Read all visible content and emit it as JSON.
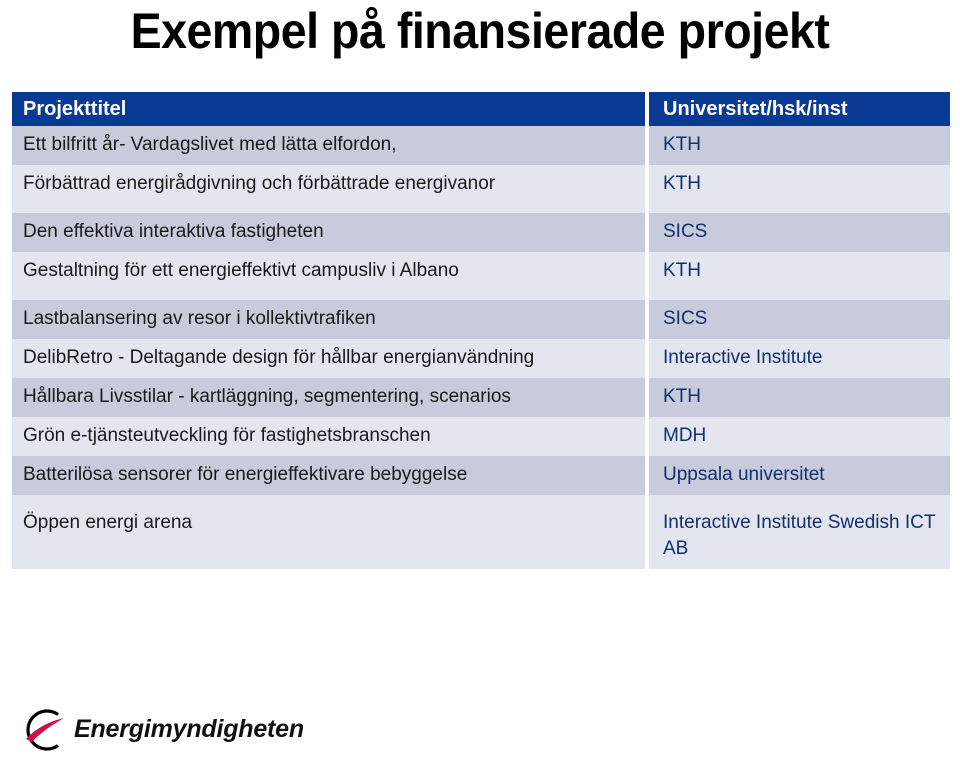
{
  "slide": {
    "title": "Exempel på finansierade projekt"
  },
  "table": {
    "columns": [
      {
        "key": "title",
        "header": "Projekttitel"
      },
      {
        "key": "org",
        "header": "Universitet/hsk/inst"
      }
    ],
    "rows": [
      {
        "title": "Ett bilfritt år- Vardagslivet med lätta elfordon,",
        "org": "KTH"
      },
      {
        "title": "Förbättrad energirådgivning och förbättrade energivanor",
        "org": "KTH"
      },
      {
        "title": "Den effektiva interaktiva fastigheten",
        "org": "SICS"
      },
      {
        "title": "Gestaltning för ett energieffektivt campusliv i Albano",
        "org": "KTH"
      },
      {
        "title": "Lastbalansering av resor i kollektivtrafiken",
        "org": "SICS"
      },
      {
        "title": "DelibRetro - Deltagande design för hållbar energianvändning",
        "org": "Interactive Institute"
      },
      {
        "title": "Hållbara Livsstilar - kartläggning, segmentering, scenarios",
        "org": "KTH"
      },
      {
        "title": "Grön e-tjänsteutveckling för fastighetsbranschen",
        "org": "MDH"
      },
      {
        "title": "Batterilösa sensorer för energieffektivare bebyggelse",
        "org": "Uppsala universitet"
      },
      {
        "title": "Öppen energi arena",
        "org": "Interactive Institute Swedish ICT AB"
      }
    ]
  },
  "logo": {
    "name": "Energimyndigheten",
    "mark_ring_color": "#000000",
    "mark_swoosh_color": "#cc1144"
  },
  "colors": {
    "header_blue": "#0b3a94",
    "row_dark": "#c7cbdb",
    "row_light": "#e3e5ef",
    "org_text": "#12306e",
    "title_text": "#000000"
  }
}
